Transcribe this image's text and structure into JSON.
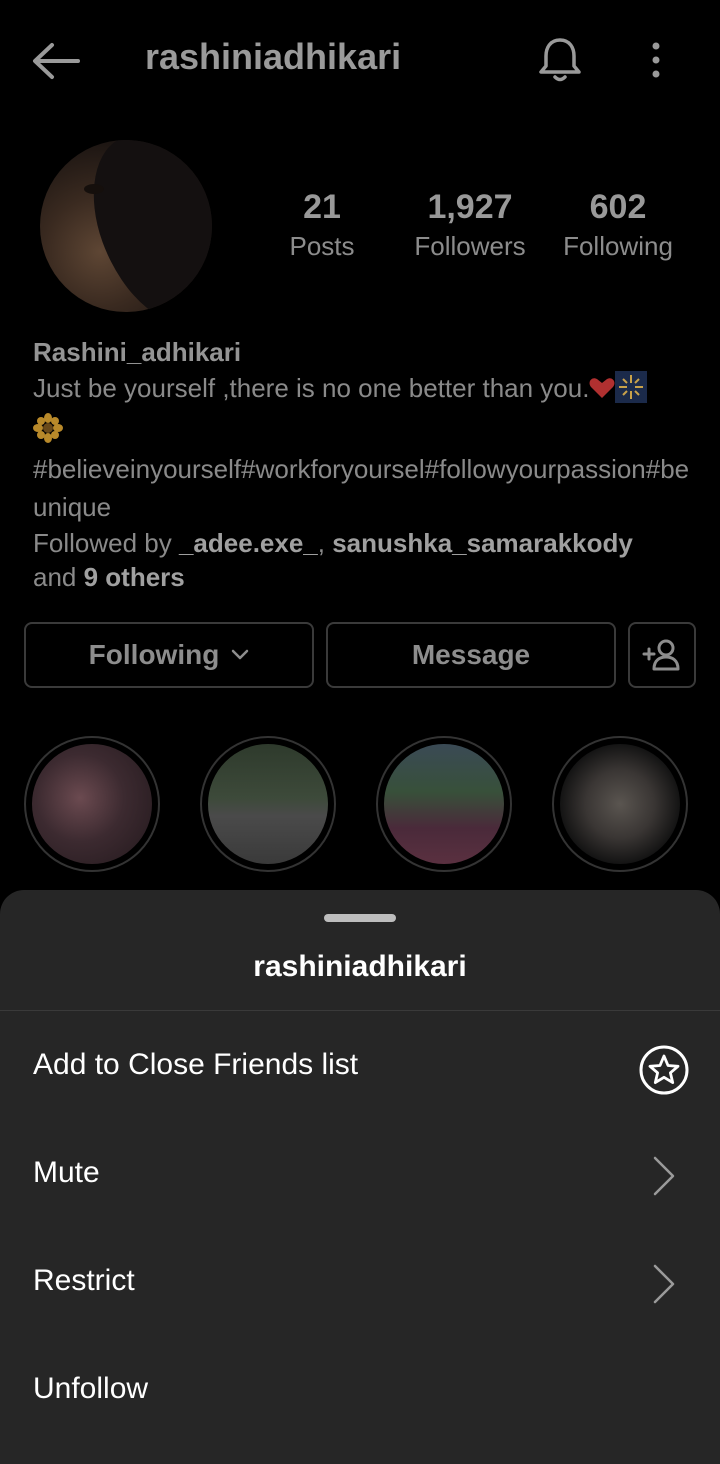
{
  "topbar": {
    "username": "rashiniadhikari"
  },
  "stats": {
    "posts": {
      "value": "21",
      "label": "Posts"
    },
    "followers": {
      "value": "1,927",
      "label": "Followers"
    },
    "following": {
      "value": "602",
      "label": "Following"
    }
  },
  "bio": {
    "name": "Rashini_adhikari",
    "line1": "Just be yourself ,there is no one better than you.",
    "hashtags": "#believeinyourself#workforyoursel#followyourpassion#beunique",
    "followed_prefix": "Followed by ",
    "followed_user1": "_adee.exe_",
    "followed_sep": ", ",
    "followed_user2": "sanushka_samarakkody",
    "followed_and": "and ",
    "followed_others": "9 others"
  },
  "buttons": {
    "following": "Following",
    "message": "Message"
  },
  "sheet": {
    "title": "rashiniadhikari",
    "options": [
      {
        "label": "Add to Close Friends list",
        "icon": "star-circle-icon"
      },
      {
        "label": "Mute",
        "icon": "chevron-right-icon"
      },
      {
        "label": "Restrict",
        "icon": "chevron-right-icon"
      },
      {
        "label": "Unfollow",
        "icon": ""
      }
    ]
  },
  "colors": {
    "background": "#000000",
    "sheet": "#262626",
    "heart": "#c0392b"
  }
}
